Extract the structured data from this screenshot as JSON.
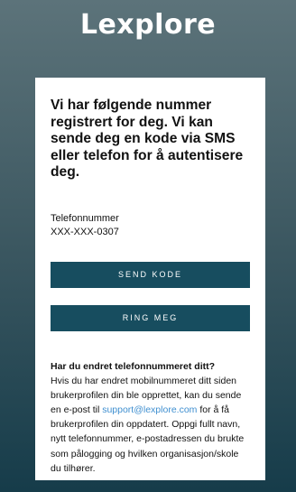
{
  "header": {
    "logo_text": "Lexplore"
  },
  "card": {
    "heading": "Vi har følgende nummer registrert for deg. Vi kan sende deg en kode via SMS eller telefon for å autentisere deg.",
    "phone_label": "Telefonnummer",
    "phone_value": "XXX-XXX-0307",
    "send_code_label": "SEND KODE",
    "call_me_label": "RING MEG",
    "changed_title": "Har du endret telefonnummeret ditt?",
    "changed_text_before": "Hvis du har endret mobilnummeret ditt siden brukerprofilen din ble opprettet, kan du sende en e-post til ",
    "support_email": "support@lexplore.com",
    "changed_text_after": " for å få brukerprofilen din oppdatert. Oppgi fullt navn, nytt telefonnummer, e-postadressen du brukte som pålogging og hvilken organisasjon/skole du tilhører."
  },
  "colors": {
    "button_bg": "#174d5f",
    "link": "#3f8fd0",
    "background_top": "#5c737a",
    "background_bottom": "#163c4a"
  }
}
